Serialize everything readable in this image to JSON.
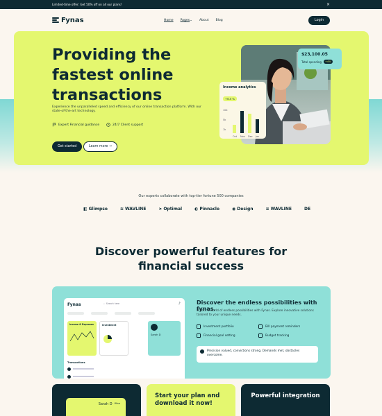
{
  "announcement": {
    "text": "Limited-time offer: Get 50% off on all our plans!",
    "close": "×"
  },
  "nav": {
    "brand": "Fynas",
    "links": [
      "Home",
      "Pages",
      "About",
      "Blog"
    ],
    "pages_caret": "⌄",
    "login": "Login"
  },
  "hero": {
    "title": "Providing the fastest online transactions",
    "description": "Experience the unparalleled speed and efficiency of our online transaction platform. With our state-of-the-art technology.",
    "features": [
      "Expert Financial guidance",
      "24/7 Client support"
    ],
    "primary_button": "Get started",
    "secondary_button": "Learn more",
    "secondary_arrow": "→",
    "balance_card": {
      "amount": "$23,100.05",
      "label": "Total spending",
      "badge": "+4%"
    },
    "income_card": {
      "title": "Income analytics",
      "badge": "+6.5 %",
      "y_ticks": [
        "10k",
        "5k",
        "1k"
      ],
      "x_labels": [
        "Oct",
        "Nov",
        "Dec",
        "Jan"
      ]
    }
  },
  "chart_data": {
    "type": "bar",
    "title": "Income analytics",
    "categories": [
      "Oct",
      "Nov",
      "Dec",
      "Jan"
    ],
    "values": [
      3,
      8,
      7,
      5
    ],
    "ylim": [
      0,
      10
    ]
  },
  "partners": {
    "title": "Our experts collaborate with top-tier fortune 500 companies",
    "logos": [
      "Glimpse",
      "WAVLINE",
      "Optimal",
      "Pinnacle",
      "Design",
      "WAVLINE",
      "DE"
    ]
  },
  "features_section": {
    "heading_line1": "Discover powerful features for",
    "heading_line2": "financial success",
    "dashboard": {
      "brand": "Fynas",
      "search_placeholder": "Search here",
      "user": "Sarah D",
      "income_title": "Income & Expenses",
      "investment_title": "Investment",
      "transactions_title": "Transactions"
    },
    "title": "Discover the endless possibilities with fynas.",
    "description": "Unlock a world of endless possibilities with Fynas. Explore innovative solutions tailored to your unique needs.",
    "items": [
      "Investment portfolio",
      "Financial goal setting",
      "Bill payment reminders",
      "Budget tracking"
    ],
    "quote": "Precision valued, convictions strong. Demands met, obstacles overcome."
  },
  "bottom_cards": {
    "card1_name": "Sarah D",
    "card1_brand": "Wise",
    "card2_title": "Start your plan and download it now!",
    "card3_title": "Powerful integration"
  },
  "colors": {
    "dark": "#0d2a33",
    "lime": "#e4f76f",
    "teal": "#8fe0d8",
    "cream": "#fbf6ef"
  }
}
